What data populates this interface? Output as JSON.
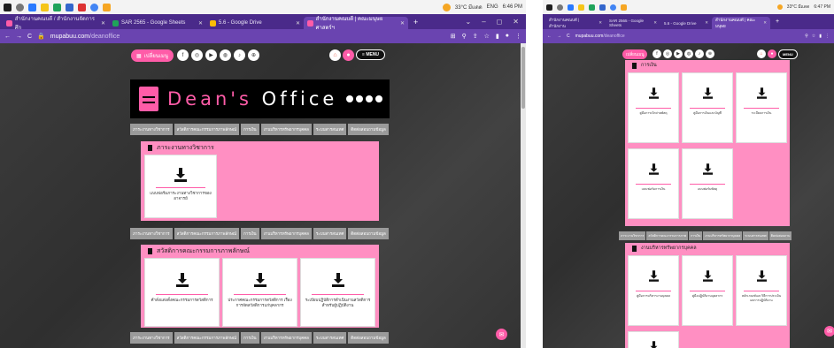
{
  "colors": {
    "brand_pink": "#ff5ca8",
    "section_pink": "#ff8fc2",
    "browser_purple": "#6a44b0",
    "nav_gray": "#9a9a9a"
  },
  "left": {
    "taskbar": {
      "weather": "33°C มีแดด",
      "lang": "ENG",
      "time": "6:46 PM"
    },
    "tabs": [
      {
        "label": "สำนักงานคณบดี / สำนักงานจัดการศึก",
        "icon": "site-icon"
      },
      {
        "label": "SAR 2565 - Google Sheets",
        "icon": "sheets-icon"
      },
      {
        "label": "5.6 - Google Drive",
        "icon": "drive-icon"
      },
      {
        "label": "สำนักงานคณบดี | คณะมนุษยศาสตร์ฯ",
        "icon": "site-icon"
      }
    ],
    "url": {
      "host": "mupabuu.com",
      "path": "/deanoffice"
    },
    "topnav": {
      "left_pill": "เปลี่ยนเมนู",
      "menu": "MENU"
    },
    "banner": {
      "title_pink": "Dean's",
      "title_white": "Office"
    },
    "catnav": [
      "ภาระงานทางวิชาการ",
      "สวัสดิการคณะกรรมการภาพลักษณ์",
      "การเงิน",
      "งานบริหารทรัพยากรบุคคล",
      "ระบบสารสนเทศ",
      "ติดต่อสอบถามข้อมูล"
    ],
    "section1": {
      "title": "ภาระงานทางวิชาการ",
      "cards": [
        {
          "caption": "แบบฟอร์มภาระงานทางวิชาการของอาจารย์"
        }
      ]
    },
    "section2": {
      "title": "สวัสดิการคณะกรรมการภาพลักษณ์",
      "cards": [
        {
          "caption": "คำสั่งแต่งตั้งคณะกรรมการสวัสดิการ"
        },
        {
          "caption": "ประกาศคณะกรรมการสวัสดิการ เรื่อง การจัดสวัสดิการแก่บุคลากร"
        },
        {
          "caption": "ระเบียบปฏิบัติการดำเนินงานสวัสดิการ สำหรับผู้ปฏิบัติงาน"
        }
      ]
    }
  },
  "right": {
    "taskbar": {
      "weather": "33°C มีแดด",
      "time": "6:47 PM"
    },
    "tabs": [
      {
        "label": "สำนักงานคณบดี | สำนักงาน"
      },
      {
        "label": "SAR 2565 - Google Sheets"
      },
      {
        "label": "5.6 - Google Drive"
      },
      {
        "label": "สำนักงานคณบดี | คณะมนุษย"
      }
    ],
    "url": {
      "host": "mupabuu.com",
      "path": "/deanoffice"
    },
    "topnav": {
      "left_pill": "เปลี่ยนเมนู",
      "menu": "MENU"
    },
    "section_finance": {
      "title": "การเงิน",
      "cards": [
        {
          "caption": "คู่มือการเบิกจ่ายพัสดุ"
        },
        {
          "caption": "คู่มือการเงินและบัญชี"
        },
        {
          "caption": "ระเบียบการเงิน"
        },
        {
          "caption": "แบบฟอร์มการเงิน"
        },
        {
          "caption": "แบบฟอร์มพัสดุ"
        }
      ]
    },
    "catnav": [
      "ภาระงานวิชาการ",
      "สวัสดิการคณะกรรมการภาพ",
      "การเงิน",
      "งานบริหารทรัพยากรบุคคล",
      "ระบบสารสนเทศ",
      "ติดต่อสอบถาม"
    ],
    "section_hr": {
      "title": "งานบริหารทรัพยากรบุคคล",
      "cards": [
        {
          "caption": "คู่มือการบริหารงานบุคคล"
        },
        {
          "caption": "คู่มือปฏิบัติงานบุคลากร"
        },
        {
          "caption": "หลักเกณฑ์และวิธีการประเมินผลการปฏิบัติงาน"
        }
      ]
    }
  }
}
